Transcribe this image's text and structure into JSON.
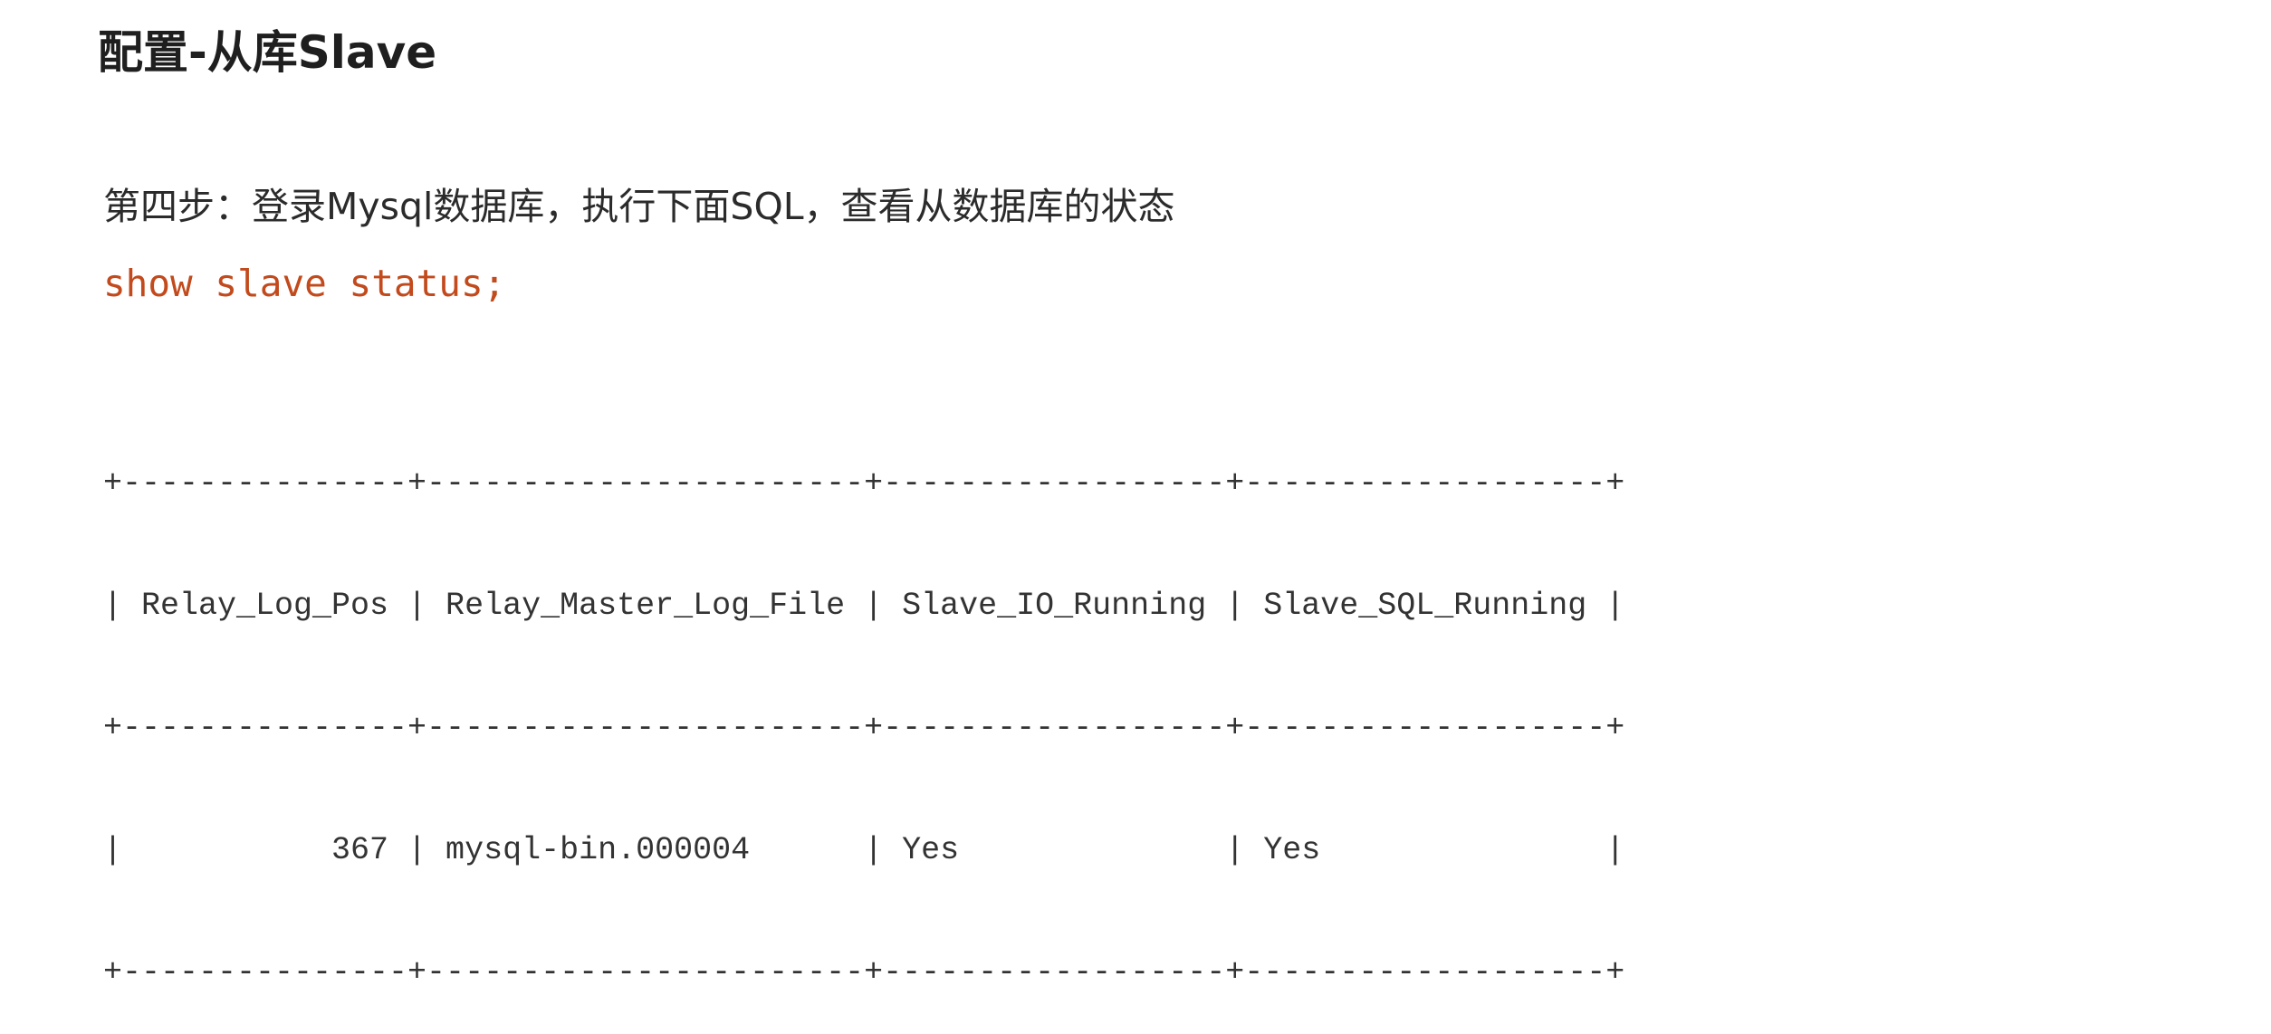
{
  "page": {
    "title": "配置-从库Slave"
  },
  "instructions": {
    "step_text": "第四步：登录Mysql数据库，执行下面SQL，查看从数据库的状态"
  },
  "code": {
    "command": "show slave status;"
  },
  "result_table": {
    "columns": [
      "Relay_Log_Pos",
      "Relay_Master_Log_File",
      "Slave_IO_Running",
      "Slave_SQL_Running"
    ],
    "rows": [
      [
        "367",
        "mysql-bin.000004",
        "Yes",
        "Yes"
      ]
    ],
    "lines": [
      "+---------------+-----------------------+------------------+-------------------+",
      "| Relay_Log_Pos | Relay_Master_Log_File | Slave_IO_Running | Slave_SQL_Running |",
      "+---------------+-----------------------+------------------+-------------------+",
      "|           367 | mysql-bin.000004      | Yes              | Yes               |",
      "+---------------+-----------------------+------------------+-------------------+"
    ]
  }
}
